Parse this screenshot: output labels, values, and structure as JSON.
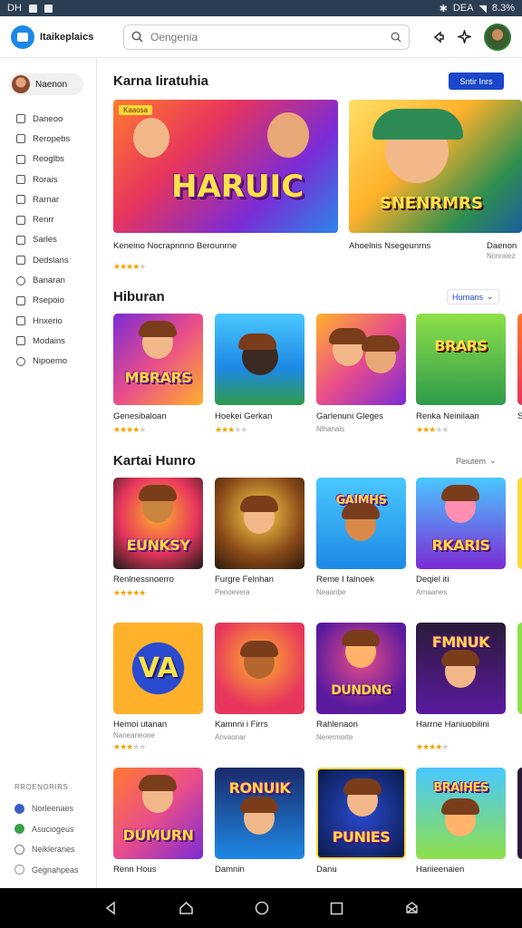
{
  "status_bar": {
    "time": "DH",
    "indicators": "DEA",
    "battery": "8.3%"
  },
  "app_bar": {
    "logo_text": "Itaikeplaics",
    "search_placeholder": "Oengenia"
  },
  "sidebar": {
    "profile_name": "Naenon",
    "items": [
      {
        "label": "Daneoo",
        "icon": "grid-icon"
      },
      {
        "label": "Reropebs",
        "icon": "list-icon"
      },
      {
        "label": "Reoglbs",
        "icon": "grid-icon"
      },
      {
        "label": "Rorais",
        "icon": "grid-icon"
      },
      {
        "label": "Rarnar",
        "icon": "home-icon"
      },
      {
        "label": "Renrr",
        "icon": "grid-icon"
      },
      {
        "label": "Sarles",
        "icon": "grid-icon"
      },
      {
        "label": "Dedslans",
        "icon": "grid-icon"
      },
      {
        "label": "Banaran",
        "icon": "heart-icon"
      },
      {
        "label": "Rsepoio",
        "icon": "tag-icon"
      },
      {
        "label": "Hnxerio",
        "icon": "flag-icon"
      },
      {
        "label": "Modains",
        "icon": "grid-icon"
      },
      {
        "label": "Nipoemo",
        "icon": "clock-icon"
      }
    ],
    "footer_title": "RROENORIRS",
    "footer_items": [
      {
        "label": "Norleenaes",
        "color": "#3b5fc9"
      },
      {
        "label": "Asuciogeus",
        "color": "#3aa04a"
      },
      {
        "label": "Neikleraries",
        "color": "#7a7a7a"
      },
      {
        "label": "Gegnahpeas",
        "color": "#9a9a9a"
      }
    ]
  },
  "sections": {
    "featured": {
      "title": "Karna Iiratuhia",
      "button_label": "Sntir Inrs",
      "cards": [
        {
          "title": "Keneino Nocrapnnno Berounrne",
          "badge": "Kaaosa",
          "art_text": "HARUIC",
          "rating": 4,
          "sub": ""
        },
        {
          "title": "Ahoelnis Nsegeunrns",
          "art_text": "SNENRMRS",
          "rating": 0,
          "sub": ""
        },
        {
          "title": "Daenon",
          "art_text": "",
          "rating": 0,
          "sub": "Ncnraiez"
        }
      ]
    },
    "hiburan": {
      "title": "Hiburan",
      "filter_label": "Hurnans",
      "tiles": [
        {
          "name": "Genesibaloan",
          "art_text": "MBRARS",
          "rating": 4,
          "sub": ""
        },
        {
          "name": "Hoekei Gerkan",
          "art_text": "",
          "rating": 3,
          "sub": ""
        },
        {
          "name": "Garlenuni Gleges",
          "art_text": "",
          "rating": 0,
          "sub": "Nlhanais"
        },
        {
          "name": "Renka Neinilaan",
          "art_text": "BRARS",
          "rating": 3,
          "sub": ""
        },
        {
          "name": "S",
          "art_text": "",
          "rating": 0,
          "sub": ""
        }
      ]
    },
    "kartai": {
      "title": "Kartai Hunro",
      "filter_label": "Peiutem",
      "rows": [
        [
          {
            "name": "Renlnessnoerro",
            "art_text": "EUNKSY",
            "rating": 5,
            "sub": ""
          },
          {
            "name": "Furgre Felnhan",
            "art_text": "",
            "rating": 0,
            "sub": "Penoevera"
          },
          {
            "name": "Reme I falnoek",
            "art_text": "GAIMHS",
            "rating": 0,
            "sub": "Neaanbe"
          },
          {
            "name": "Deqiel iti",
            "art_text": "RKARIS",
            "rating": 0,
            "sub": "Arnaanes"
          }
        ],
        [
          {
            "name": "Hemoi utanan",
            "art_text": "VA",
            "rating": 0,
            "sub": "Naneaneone"
          },
          {
            "name": "Kamnni i Firrs",
            "art_text": "",
            "rating": 0,
            "sub": "Anvaonar"
          },
          {
            "name": "Rahlenaon",
            "art_text": "DUNDNG",
            "rating": 0,
            "sub": "Nerermorte"
          },
          {
            "name": "Harrne Haniuobilini",
            "art_text": "FMNUK",
            "rating": 4,
            "sub": ""
          }
        ],
        [
          {
            "name": "Renn Hous",
            "art_text": "DUMURN",
            "rating": 0,
            "sub": ""
          },
          {
            "name": "Damnin",
            "art_text": "RONUIK",
            "rating": 0,
            "sub": ""
          },
          {
            "name": "Danu",
            "art_text": "PUNIES",
            "rating": 0,
            "sub": ""
          },
          {
            "name": "Hariieenaien",
            "art_text": "BRAIHES",
            "rating": 0,
            "sub": ""
          }
        ]
      ]
    }
  },
  "colors": {
    "accent": "#1a47c9",
    "star": "#f2a200",
    "status_bar": "#2c3d52",
    "nav_bar": "#000000"
  }
}
